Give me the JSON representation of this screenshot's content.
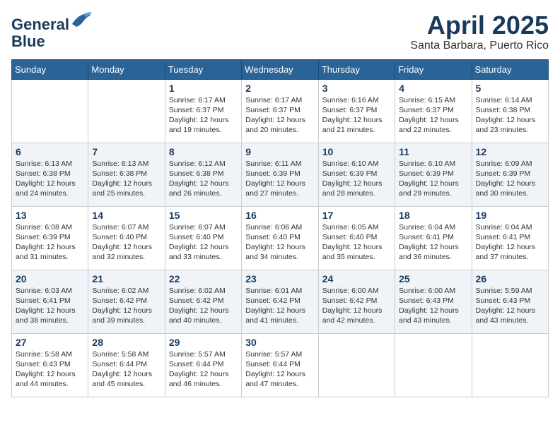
{
  "header": {
    "logo_line1": "General",
    "logo_line2": "Blue",
    "month_year": "April 2025",
    "location": "Santa Barbara, Puerto Rico"
  },
  "weekdays": [
    "Sunday",
    "Monday",
    "Tuesday",
    "Wednesday",
    "Thursday",
    "Friday",
    "Saturday"
  ],
  "weeks": [
    [
      {
        "day": "",
        "info": ""
      },
      {
        "day": "",
        "info": ""
      },
      {
        "day": "1",
        "info": "Sunrise: 6:17 AM\nSunset: 6:37 PM\nDaylight: 12 hours\nand 19 minutes."
      },
      {
        "day": "2",
        "info": "Sunrise: 6:17 AM\nSunset: 6:37 PM\nDaylight: 12 hours\nand 20 minutes."
      },
      {
        "day": "3",
        "info": "Sunrise: 6:16 AM\nSunset: 6:37 PM\nDaylight: 12 hours\nand 21 minutes."
      },
      {
        "day": "4",
        "info": "Sunrise: 6:15 AM\nSunset: 6:37 PM\nDaylight: 12 hours\nand 22 minutes."
      },
      {
        "day": "5",
        "info": "Sunrise: 6:14 AM\nSunset: 6:38 PM\nDaylight: 12 hours\nand 23 minutes."
      }
    ],
    [
      {
        "day": "6",
        "info": "Sunrise: 6:13 AM\nSunset: 6:38 PM\nDaylight: 12 hours\nand 24 minutes."
      },
      {
        "day": "7",
        "info": "Sunrise: 6:13 AM\nSunset: 6:38 PM\nDaylight: 12 hours\nand 25 minutes."
      },
      {
        "day": "8",
        "info": "Sunrise: 6:12 AM\nSunset: 6:38 PM\nDaylight: 12 hours\nand 26 minutes."
      },
      {
        "day": "9",
        "info": "Sunrise: 6:11 AM\nSunset: 6:39 PM\nDaylight: 12 hours\nand 27 minutes."
      },
      {
        "day": "10",
        "info": "Sunrise: 6:10 AM\nSunset: 6:39 PM\nDaylight: 12 hours\nand 28 minutes."
      },
      {
        "day": "11",
        "info": "Sunrise: 6:10 AM\nSunset: 6:39 PM\nDaylight: 12 hours\nand 29 minutes."
      },
      {
        "day": "12",
        "info": "Sunrise: 6:09 AM\nSunset: 6:39 PM\nDaylight: 12 hours\nand 30 minutes."
      }
    ],
    [
      {
        "day": "13",
        "info": "Sunrise: 6:08 AM\nSunset: 6:39 PM\nDaylight: 12 hours\nand 31 minutes."
      },
      {
        "day": "14",
        "info": "Sunrise: 6:07 AM\nSunset: 6:40 PM\nDaylight: 12 hours\nand 32 minutes."
      },
      {
        "day": "15",
        "info": "Sunrise: 6:07 AM\nSunset: 6:40 PM\nDaylight: 12 hours\nand 33 minutes."
      },
      {
        "day": "16",
        "info": "Sunrise: 6:06 AM\nSunset: 6:40 PM\nDaylight: 12 hours\nand 34 minutes."
      },
      {
        "day": "17",
        "info": "Sunrise: 6:05 AM\nSunset: 6:40 PM\nDaylight: 12 hours\nand 35 minutes."
      },
      {
        "day": "18",
        "info": "Sunrise: 6:04 AM\nSunset: 6:41 PM\nDaylight: 12 hours\nand 36 minutes."
      },
      {
        "day": "19",
        "info": "Sunrise: 6:04 AM\nSunset: 6:41 PM\nDaylight: 12 hours\nand 37 minutes."
      }
    ],
    [
      {
        "day": "20",
        "info": "Sunrise: 6:03 AM\nSunset: 6:41 PM\nDaylight: 12 hours\nand 38 minutes."
      },
      {
        "day": "21",
        "info": "Sunrise: 6:02 AM\nSunset: 6:42 PM\nDaylight: 12 hours\nand 39 minutes."
      },
      {
        "day": "22",
        "info": "Sunrise: 6:02 AM\nSunset: 6:42 PM\nDaylight: 12 hours\nand 40 minutes."
      },
      {
        "day": "23",
        "info": "Sunrise: 6:01 AM\nSunset: 6:42 PM\nDaylight: 12 hours\nand 41 minutes."
      },
      {
        "day": "24",
        "info": "Sunrise: 6:00 AM\nSunset: 6:42 PM\nDaylight: 12 hours\nand 42 minutes."
      },
      {
        "day": "25",
        "info": "Sunrise: 6:00 AM\nSunset: 6:43 PM\nDaylight: 12 hours\nand 43 minutes."
      },
      {
        "day": "26",
        "info": "Sunrise: 5:59 AM\nSunset: 6:43 PM\nDaylight: 12 hours\nand 43 minutes."
      }
    ],
    [
      {
        "day": "27",
        "info": "Sunrise: 5:58 AM\nSunset: 6:43 PM\nDaylight: 12 hours\nand 44 minutes."
      },
      {
        "day": "28",
        "info": "Sunrise: 5:58 AM\nSunset: 6:44 PM\nDaylight: 12 hours\nand 45 minutes."
      },
      {
        "day": "29",
        "info": "Sunrise: 5:57 AM\nSunset: 6:44 PM\nDaylight: 12 hours\nand 46 minutes."
      },
      {
        "day": "30",
        "info": "Sunrise: 5:57 AM\nSunset: 6:44 PM\nDaylight: 12 hours\nand 47 minutes."
      },
      {
        "day": "",
        "info": ""
      },
      {
        "day": "",
        "info": ""
      },
      {
        "day": "",
        "info": ""
      }
    ]
  ]
}
